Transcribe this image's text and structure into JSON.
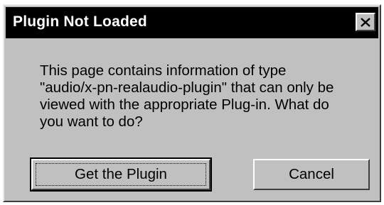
{
  "dialog": {
    "title": "Plugin Not Loaded",
    "close_icon": "close-icon",
    "message_lines": [
      "This page contains information of type",
      "\"audio/x-pn-realaudio-plugin\" that can only be",
      "viewed with the appropriate Plug-in. What do",
      "you want to do?"
    ],
    "buttons": {
      "get_plugin": "Get the Plugin",
      "cancel": "Cancel"
    }
  },
  "colors": {
    "titlebar": "#000000",
    "dialog_face": "#c0c0c0"
  }
}
